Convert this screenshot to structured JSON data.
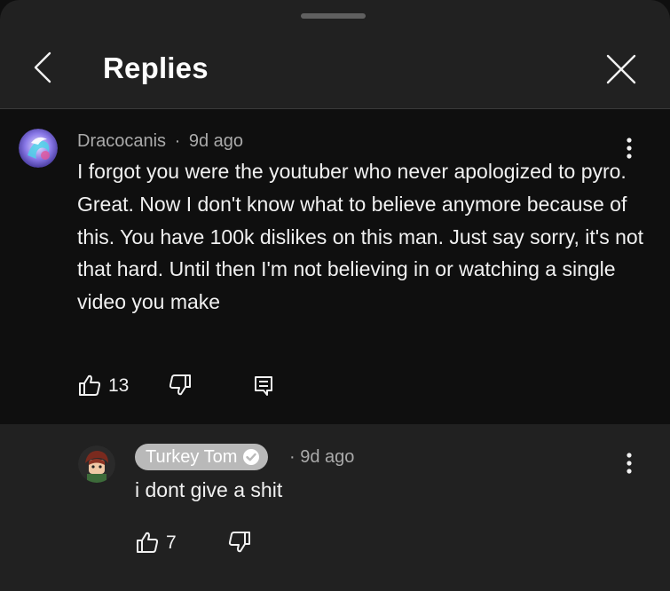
{
  "header": {
    "title": "Replies",
    "back_icon": "chevron-left-icon",
    "close_icon": "close-icon"
  },
  "parent_comment": {
    "author": "Dracocanis",
    "separator": "·",
    "time": "9d ago",
    "text": "I forgot you were the youtuber who never apologized to pyro. Great. Now I don't know what to believe anymore because of this. You have 100k dislikes on this man. Just say sorry, it's not that hard. Until then I'm not believing in or watching a single video you make",
    "like_count": "13"
  },
  "reply": {
    "author": "Turkey Tom",
    "verified": true,
    "time": "· 9d ago",
    "text": "i dont give a shit",
    "like_count": "7"
  },
  "colors": {
    "sheet_bg": "#212121",
    "parent_bg": "#0f0f0f",
    "text": "#f1f1f1",
    "secondary_text": "#aaaaaa",
    "author_chip": "#b9b9b9"
  }
}
